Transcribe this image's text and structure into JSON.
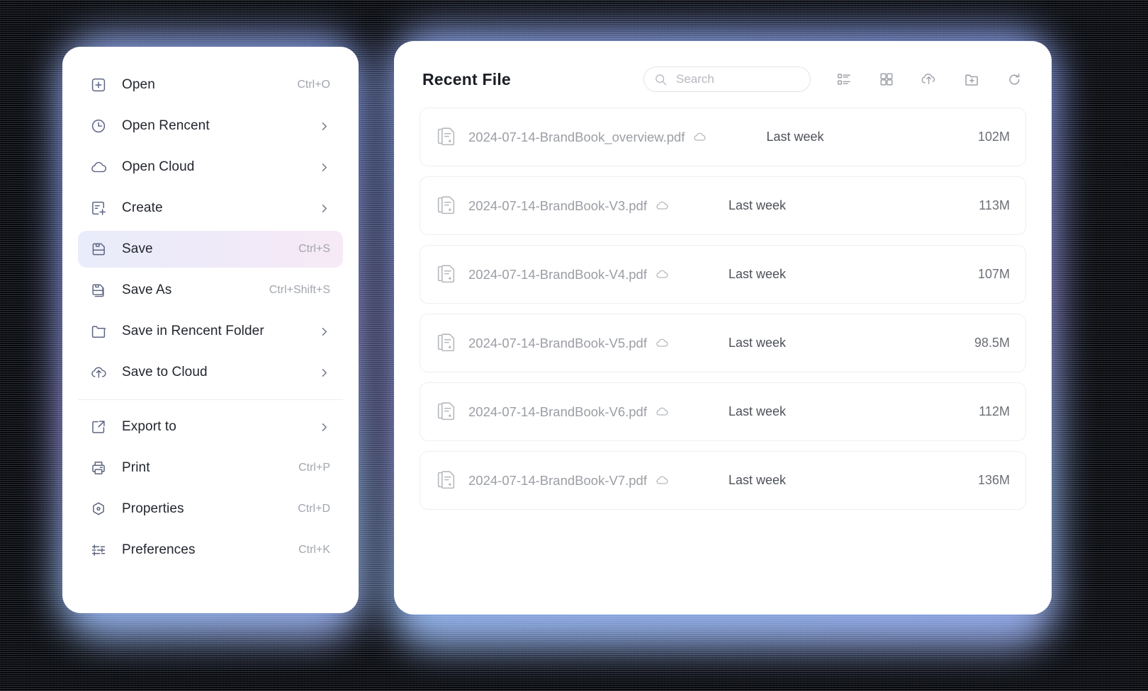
{
  "menu": {
    "items": [
      {
        "label": "Open",
        "icon": "open-file-icon",
        "shortcut": "Ctrl+O",
        "submenu": false,
        "active": false
      },
      {
        "label": "Open Rencent",
        "icon": "clock-icon",
        "shortcut": "",
        "submenu": true,
        "active": false
      },
      {
        "label": "Open Cloud",
        "icon": "cloud-icon",
        "shortcut": "",
        "submenu": true,
        "active": false
      },
      {
        "label": "Create",
        "icon": "create-document-icon",
        "shortcut": "",
        "submenu": true,
        "active": false
      },
      {
        "label": "Save",
        "icon": "floppy-disk-icon",
        "shortcut": "Ctrl+S",
        "submenu": false,
        "active": true
      },
      {
        "label": "Save As",
        "icon": "floppy-disk-copy-icon",
        "shortcut": "Ctrl+Shift+S",
        "submenu": false,
        "active": false
      },
      {
        "label": "Save in Rencent Folder",
        "icon": "folder-icon",
        "shortcut": "",
        "submenu": true,
        "active": false
      },
      {
        "label": "Save to Cloud",
        "icon": "cloud-upload-icon",
        "shortcut": "",
        "submenu": true,
        "active": false
      }
    ],
    "items_after_divider": [
      {
        "label": "Export to",
        "icon": "export-icon",
        "shortcut": "",
        "submenu": true,
        "active": false
      },
      {
        "label": "Print",
        "icon": "printer-icon",
        "shortcut": "Ctrl+P",
        "submenu": false,
        "active": false
      },
      {
        "label": "Properties",
        "icon": "hexagon-info-icon",
        "shortcut": "Ctrl+D",
        "submenu": false,
        "active": false
      },
      {
        "label": "Preferences",
        "icon": "sliders-icon",
        "shortcut": "Ctrl+K",
        "submenu": false,
        "active": false
      }
    ]
  },
  "files_panel": {
    "title": "Recent File",
    "search": {
      "value": "",
      "placeholder": "Search",
      "icon": "search-icon"
    },
    "tools": [
      {
        "name": "list-view-icon",
        "label": "List view"
      },
      {
        "name": "grid-view-icon",
        "label": "Grid view"
      },
      {
        "name": "cloud-upload-icon",
        "label": "Upload to cloud"
      },
      {
        "name": "new-folder-icon",
        "label": "New folder"
      },
      {
        "name": "refresh-icon",
        "label": "Refresh"
      }
    ],
    "rows": [
      {
        "name": "2024-07-14-BrandBook_overview.pdf",
        "cloud": true,
        "date": "Last week",
        "size": "102M"
      },
      {
        "name": "2024-07-14-BrandBook-V3.pdf",
        "cloud": true,
        "date": "Last week",
        "size": "113M"
      },
      {
        "name": "2024-07-14-BrandBook-V4.pdf",
        "cloud": true,
        "date": "Last week",
        "size": "107M"
      },
      {
        "name": "2024-07-14-BrandBook-V5.pdf",
        "cloud": true,
        "date": "Last week",
        "size": "98.5M"
      },
      {
        "name": "2024-07-14-BrandBook-V6.pdf",
        "cloud": true,
        "date": "Last week",
        "size": "112M"
      },
      {
        "name": "2024-07-14-BrandBook-V7.pdf",
        "cloud": true,
        "date": "Last week",
        "size": "136M"
      }
    ]
  },
  "colors": {
    "active_highlight_start": "#e9ecfb",
    "active_highlight_end": "#f7eaf6",
    "backdrop_glow": "#8fa8ef",
    "card_background": "#ffffff",
    "page_background": "#000000"
  }
}
